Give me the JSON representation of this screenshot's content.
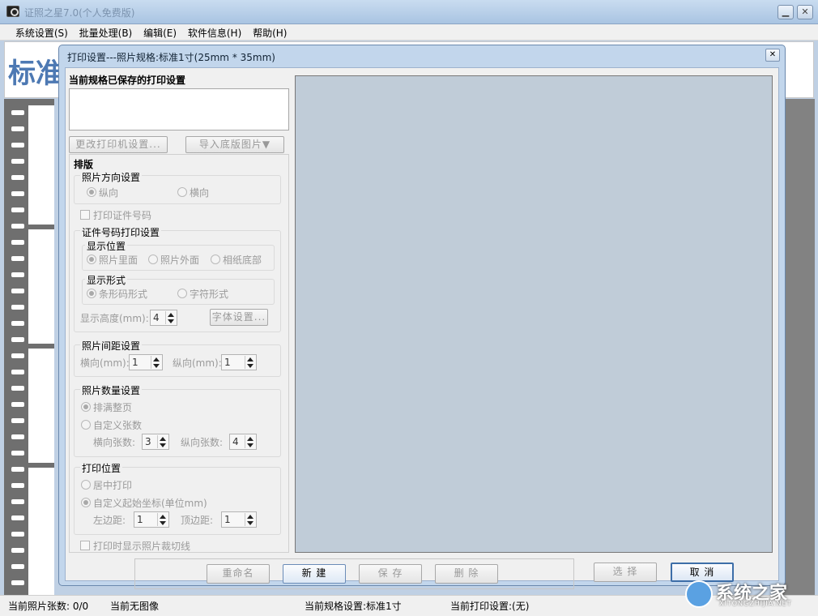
{
  "window": {
    "title": "证照之星7.0(个人免费版)"
  },
  "menu": [
    "系统设置(S)",
    "批量处理(B)",
    "编辑(E)",
    "软件信息(H)",
    "帮助(H)"
  ],
  "background": {
    "big_label": "标准"
  },
  "status": {
    "count": "当前照片张数: 0/0",
    "image": "当前无图像",
    "spec": "当前规格设置:标准1寸",
    "print": "当前打印设置:(无)"
  },
  "dialog": {
    "title": "打印设置---照片规格:标准1寸(25mm * 35mm)",
    "saved_heading": "当前规格已保存的打印设置",
    "change_printer": "更改打印机设置...",
    "import_bg": "导入底版图片▼",
    "layout_heading": "排版",
    "orientation": {
      "label": "照片方向设置",
      "portrait": "纵向",
      "landscape": "横向",
      "selected": "portrait"
    },
    "print_id": {
      "label": "打印证件号码",
      "checked": false
    },
    "id_settings": {
      "label": "证件号码打印设置",
      "position": {
        "label": "显示位置",
        "options": [
          "照片里面",
          "照片外面",
          "相纸底部"
        ],
        "selected": 0
      },
      "form": {
        "label": "显示形式",
        "options": [
          "条形码形式",
          "字符形式"
        ],
        "selected": 0
      },
      "height_label": "显示高度(mm):",
      "height_value": "4",
      "font_button": "字体设置..."
    },
    "spacing": {
      "label": "照片间距设置",
      "h_label": "横向(mm):",
      "h_value": "1",
      "v_label": "纵向(mm):",
      "v_value": "1"
    },
    "quantity": {
      "label": "照片数量设置",
      "fill": "排满整页",
      "custom": "自定义张数",
      "selected": "fill",
      "h_count_label": "横向张数:",
      "h_count": "3",
      "v_count_label": "纵向张数:",
      "v_count": "4"
    },
    "position": {
      "label": "打印位置",
      "center": "居中打印",
      "custom": "自定义起始坐标(单位mm)",
      "selected": "custom",
      "left_label": "左边距:",
      "left_value": "1",
      "top_label": "顶边距:",
      "top_value": "1"
    },
    "show_cut": {
      "label": "打印时显示照片裁切线",
      "checked": false
    },
    "buttons": {
      "rename": "重命名",
      "new": "新 建",
      "save": "保 存",
      "delete": "删 除",
      "select": "选 择",
      "cancel": "取 消"
    }
  },
  "watermark": {
    "text": "系统之家",
    "sub": "XITONGZHIJIA.NET"
  }
}
